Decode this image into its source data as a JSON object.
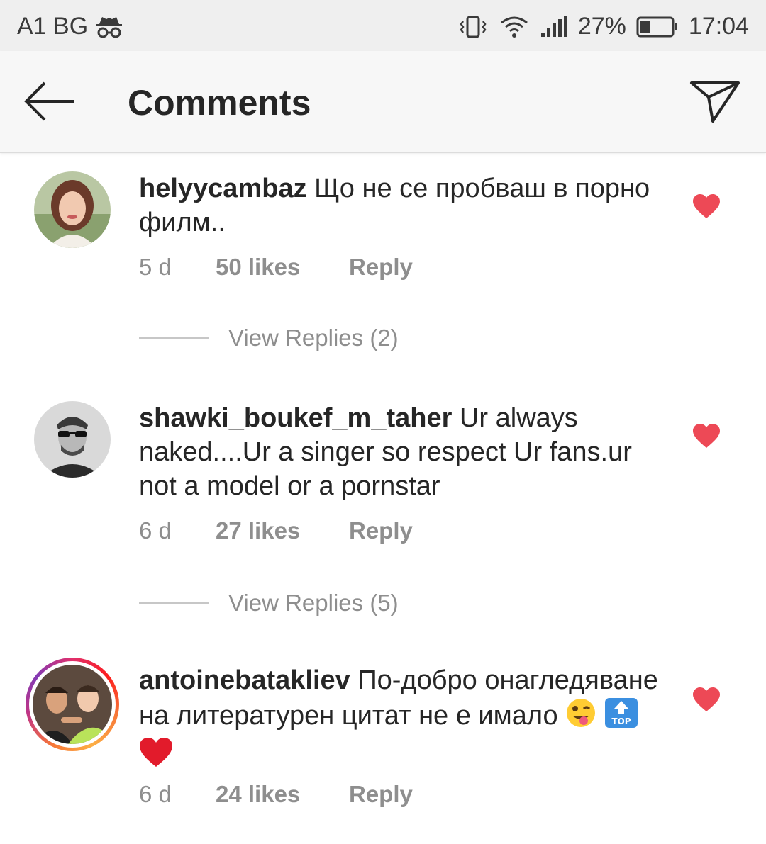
{
  "status_bar": {
    "carrier": "A1 BG",
    "battery": "27%",
    "time": "17:04"
  },
  "header": {
    "title": "Comments"
  },
  "comments": [
    {
      "username": "helyycambaz",
      "text": "Що не се пробваш в порно филм..",
      "time": "5 d",
      "likes": "50 likes",
      "reply": "Reply",
      "view_replies": "View Replies (2)"
    },
    {
      "username": "shawki_boukef_m_taher",
      "text": "Ur always naked....Ur a singer so respect Ur fans.ur not a model or a pornstar",
      "time": "6 d",
      "likes": "27 likes",
      "reply": "Reply",
      "view_replies": "View Replies (5)"
    },
    {
      "username": "antoinebatakliev",
      "text": "По-добро онагледяване на литературен цитат не е имало",
      "time": "6 d",
      "likes": "24 likes",
      "reply": "Reply",
      "emoji_top_label": "TOP"
    }
  ],
  "colors": {
    "heart": "#ed4956",
    "secondary_text": "#8e8e8e",
    "primary_text": "#262626"
  }
}
